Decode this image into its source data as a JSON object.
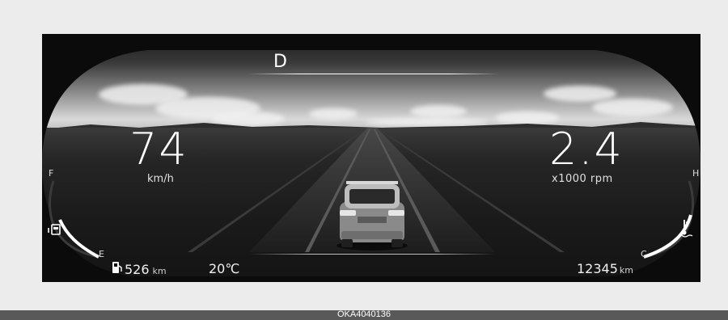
{
  "cluster": {
    "gear": "D",
    "speed": {
      "value": "74",
      "unit": "km/h"
    },
    "rpm": {
      "value": "2.4",
      "unit": "x1000 rpm"
    },
    "fuel_gauge": {
      "full_label": "F",
      "empty_label": "E",
      "level": 0.55
    },
    "temp_gauge": {
      "hot_label": "H",
      "cold_label": "C",
      "level": 0.45
    },
    "range": {
      "value": "526",
      "unit": "km"
    },
    "outside_temp": "20℃",
    "odometer": {
      "value": "12345",
      "unit": "km"
    }
  },
  "caption": "OKA4040136",
  "colors": {
    "display_background": "#0d0d0d",
    "text": "#ffffff",
    "page_background": "#ececec",
    "caption_bar": "#595959"
  },
  "icons": [
    "fuel-pump-icon",
    "fuel-station-icon",
    "coolant-temp-icon",
    "vehicle-icon"
  ]
}
